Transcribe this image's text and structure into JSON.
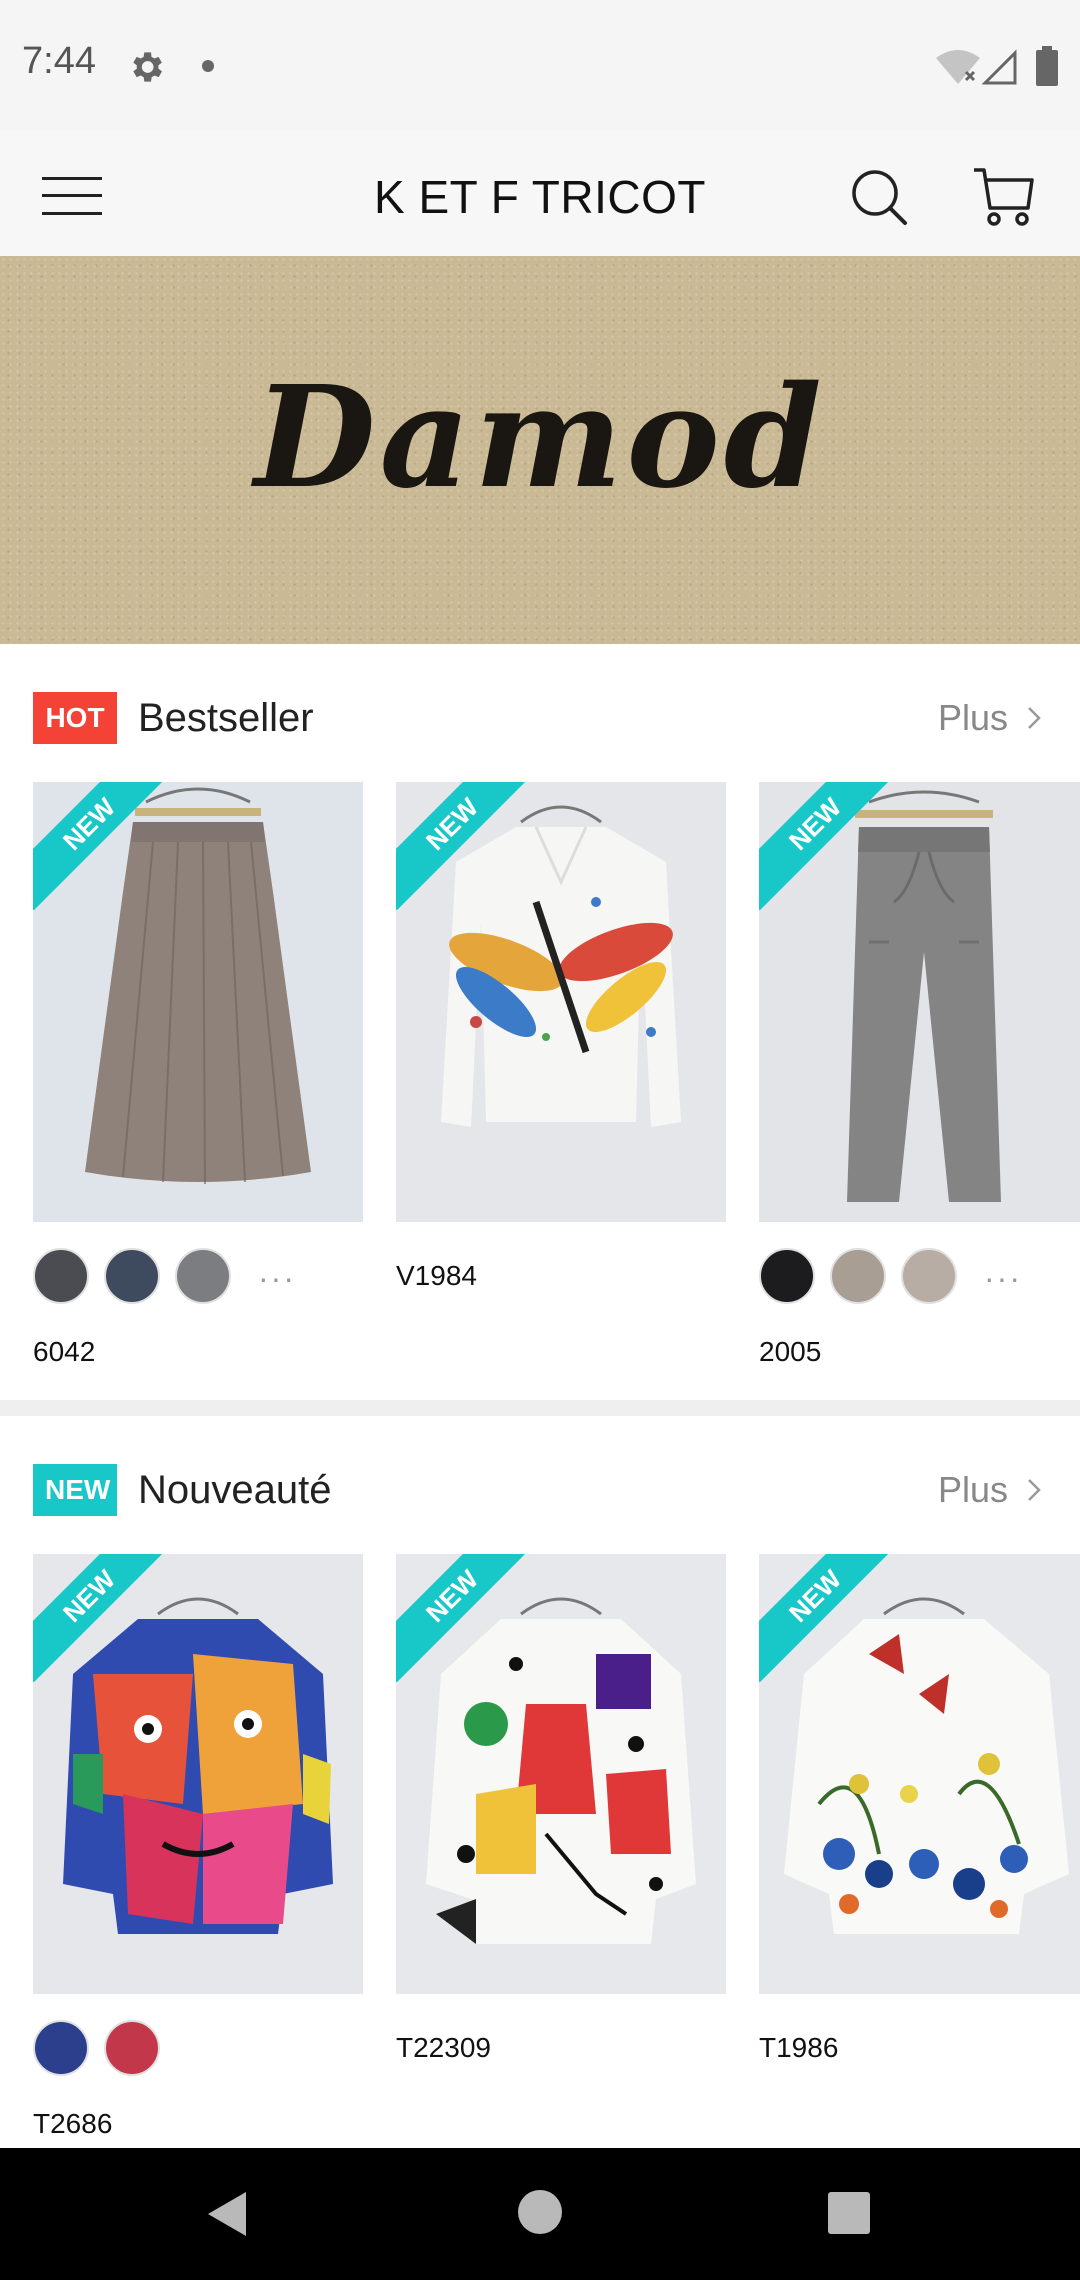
{
  "status_bar": {
    "time": "7:44",
    "icons": [
      "gear-icon",
      "notification-dot-icon",
      "wifi-off-icon",
      "signal-icon",
      "battery-icon"
    ]
  },
  "header": {
    "title": "K ET F TRICOT",
    "icons": [
      "menu-icon",
      "search-icon",
      "cart-icon"
    ]
  },
  "banner": {
    "text": "Damod",
    "color": "#c9b994"
  },
  "bestseller": {
    "badge": "HOT",
    "badge_color": "#f44336",
    "title": "Bestseller",
    "more": "Plus",
    "products": [
      {
        "code": "6042",
        "ribbon": "NEW",
        "image": "grey knit skirt on hanger",
        "swatches": [
          "#4a4c52",
          "#3e4a5e",
          "#7c7d80"
        ],
        "more_swatches": "···"
      },
      {
        "code": "V1984",
        "ribbon": "NEW",
        "image": "white sweater with dragonfly print",
        "swatches": [],
        "more_swatches": ""
      },
      {
        "code": "2005",
        "ribbon": "NEW",
        "image": "grey knit trousers on hanger",
        "swatches": [
          "#1c1c1e",
          "#a89e94",
          "#b7ada4"
        ],
        "more_swatches": "···"
      }
    ]
  },
  "nouveaute": {
    "badge": "NEW",
    "badge_color": "#18c8c8",
    "title": "Nouveauté",
    "more": "Plus",
    "products": [
      {
        "code": "T2686",
        "ribbon": "NEW",
        "image": "multicolor abstract face sweater",
        "swatches": [
          "#2b3f8c",
          "#c2384a"
        ],
        "more_swatches": ""
      },
      {
        "code": "T22309",
        "ribbon": "NEW",
        "image": "white sweater with abstract figure",
        "swatches": [],
        "more_swatches": ""
      },
      {
        "code": "T1986",
        "ribbon": "NEW",
        "image": "white sweater with floral print",
        "swatches": [],
        "more_swatches": ""
      }
    ]
  },
  "nav_bar": {
    "icons": [
      "back-icon",
      "home-icon",
      "recents-icon"
    ]
  }
}
